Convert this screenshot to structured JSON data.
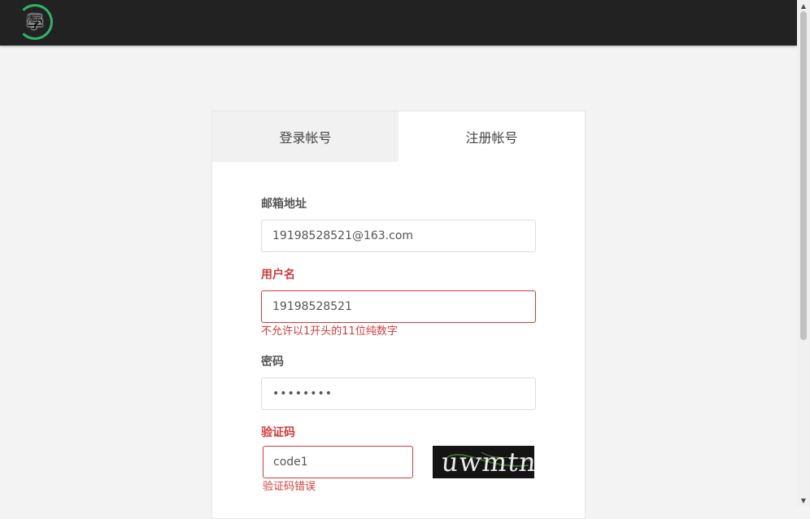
{
  "header": {
    "logo_icon": "school-logo",
    "logo_char": "學",
    "logo_small": "博宇"
  },
  "tabs": [
    {
      "label": "登录帐号",
      "active": false
    },
    {
      "label": "注册帐号",
      "active": true
    }
  ],
  "form": {
    "email": {
      "label": "邮箱地址",
      "value": "19198528521@163.com"
    },
    "username": {
      "label": "用户名",
      "value": "19198528521",
      "error": "不允许以1开头的11位纯数字"
    },
    "password": {
      "label": "密码",
      "value": "••••••••"
    },
    "captcha": {
      "label": "验证码",
      "value": "code1",
      "error": "验证码错误",
      "image_text": "uwmtn"
    }
  },
  "colors": {
    "accent": "#2fb463",
    "error": "#d23a3a",
    "topbar": "#222222"
  }
}
